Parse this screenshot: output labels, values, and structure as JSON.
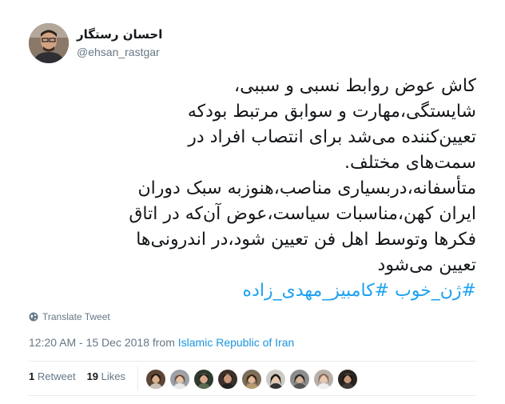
{
  "author": {
    "name": "احسان رستگار",
    "handle": "@ehsan_rastgar"
  },
  "tweet": {
    "lines": [
      "کاش عوض روابط نسبی و سببی،",
      "شایستگی،مهارت و سوابق مرتبط بودکه",
      "تعیین‌کننده می‌شد برای انتصاب افراد در",
      "سمت‌های مختلف.",
      "متأسفانه،دربسیاری مناصب،هنوزبه سبک دوران",
      "ایران کهن،مناسبات سیاست،عوض آن‌که در اتاق",
      "فکرها وتوسط اهل فن تعیین شود،در اندرونی‌ها",
      "تعیین می‌شود"
    ],
    "hashtags": "#ژن_خوب #کامبیز_مهدی_زاده"
  },
  "translate_label": "Translate Tweet",
  "timestamp": {
    "time": "12:20 AM - 15 Dec 2018 from ",
    "location": "Islamic Republic of Iran"
  },
  "stats": {
    "retweets_count": "1",
    "retweets_label": "Retweet",
    "likes_count": "19",
    "likes_label": "Likes"
  },
  "colors": {
    "link": "#1da1f2",
    "secondary_text": "#657786",
    "divider": "#e6ecf0"
  },
  "liker_avatars": [
    "liker-1",
    "liker-2",
    "liker-3",
    "liker-4",
    "liker-5",
    "liker-6",
    "liker-7",
    "liker-8",
    "liker-9"
  ]
}
